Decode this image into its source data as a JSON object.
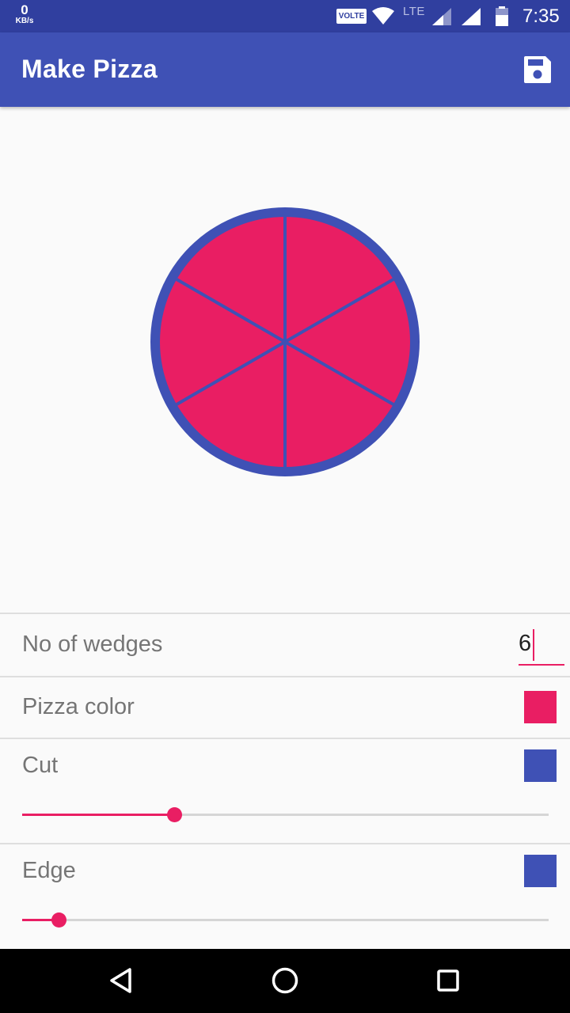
{
  "status_bar": {
    "net_speed_value": "0",
    "net_speed_unit": "KB/s",
    "volte": "VOLTE",
    "network": "LTE",
    "time": "7:35"
  },
  "app_bar": {
    "title": "Make Pizza",
    "save_icon": "save-icon"
  },
  "pizza": {
    "wedges": 6,
    "pizza_color": "#e91e63",
    "cut_color": "#3f51b5",
    "edge_color": "#3f51b5"
  },
  "settings": {
    "wedges_label": "No of wedges",
    "wedges_value": "6",
    "pizza_color_label": "Pizza color",
    "cut_label": "Cut",
    "cut_level": 0.29,
    "edge_label": "Edge",
    "edge_level": 0.07
  },
  "nav": {
    "back_icon": "back-icon",
    "home_icon": "home-icon",
    "recents_icon": "recents-icon"
  }
}
